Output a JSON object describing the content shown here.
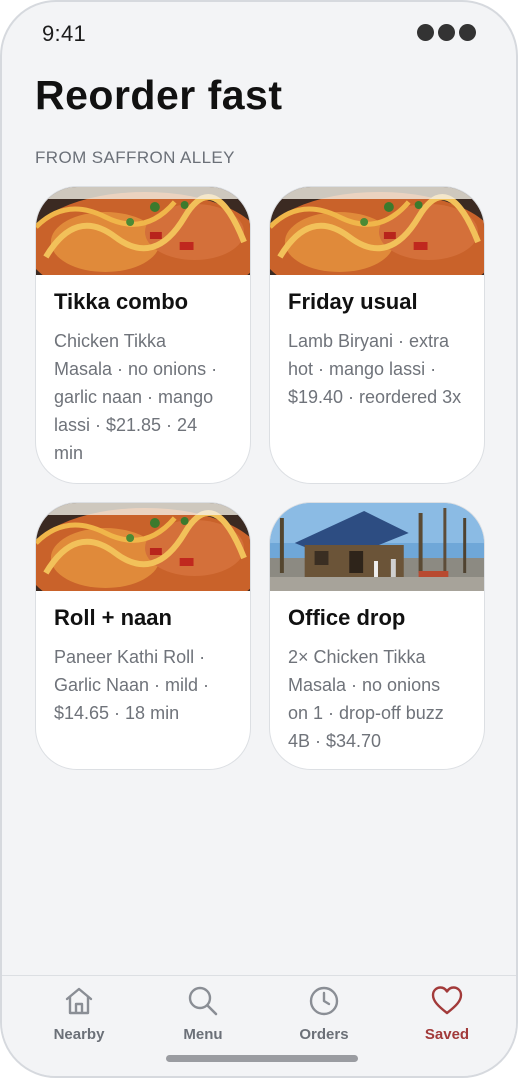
{
  "status": {
    "time": "9:41"
  },
  "page": {
    "title": "Reorder fast",
    "section_label": "FROM SAFFRON ALLEY"
  },
  "cards": [
    {
      "title": "Tikka combo",
      "description": "Chicken Tikka Masala · no onions · garlic naan · mango lassi · $21.85 · 24 min",
      "image": "curry-dish-photo"
    },
    {
      "title": "Friday usual",
      "description": "Lamb Biryani · extra hot · mango lassi · $19.40 · reordered 3x",
      "image": "curry-dish-photo"
    },
    {
      "title": "Roll + naan",
      "description": "Paneer Kathi Roll · Garlic Naan · mild · $14.65 · 18 min",
      "image": "curry-dish-photo"
    },
    {
      "title": "Office drop",
      "description": "2× Chicken Tikka Masala · no onions on 1 · drop-off buzz 4B · $34.70",
      "image": "log-cabin-photo"
    }
  ],
  "tabbar": {
    "tabs": [
      {
        "label": "Nearby",
        "icon": "home-icon",
        "active": false
      },
      {
        "label": "Menu",
        "icon": "search-icon",
        "active": false
      },
      {
        "label": "Orders",
        "icon": "clock-icon",
        "active": false
      },
      {
        "label": "Saved",
        "icon": "heart-icon",
        "active": true
      }
    ]
  },
  "colors": {
    "background": "#f3f4f6",
    "accent": "#a23a3a",
    "muted_text": "#6b7078"
  }
}
